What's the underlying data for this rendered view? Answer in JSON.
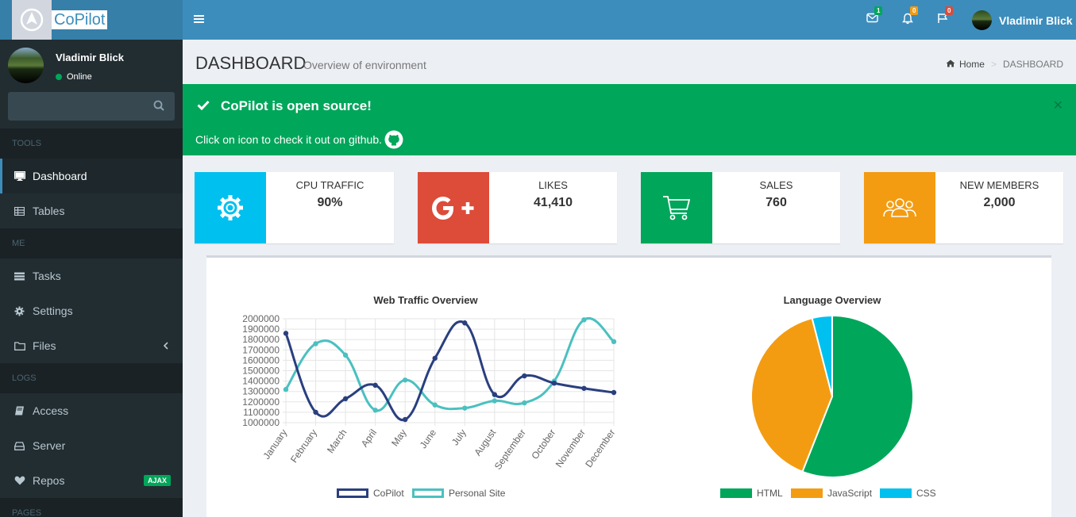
{
  "brand": {
    "name": "CoPilot"
  },
  "header": {
    "user_name": "Vladimir Blick",
    "messages_count": "1",
    "notifications_count": "0",
    "flags_count": "0"
  },
  "sidebar": {
    "user_name": "Vladimir Blick",
    "status": "Online",
    "search_placeholder": "",
    "sections": [
      {
        "header": "TOOLS",
        "items": [
          {
            "label": "Dashboard",
            "icon": "desktop-icon"
          },
          {
            "label": "Tables",
            "icon": "table-icon"
          }
        ]
      },
      {
        "header": "ME",
        "items": [
          {
            "label": "Tasks",
            "icon": "tasks-icon"
          },
          {
            "label": "Settings",
            "icon": "cog-icon"
          },
          {
            "label": "Files",
            "icon": "folder-icon"
          }
        ]
      },
      {
        "header": "LOGS",
        "items": [
          {
            "label": "Access",
            "icon": "book-icon"
          },
          {
            "label": "Server",
            "icon": "hdd-icon"
          },
          {
            "label": "Repos",
            "icon": "heart-icon",
            "badge": "AJAX"
          }
        ]
      },
      {
        "header": "PAGES"
      }
    ]
  },
  "page": {
    "title": "DASHBOARD",
    "subtitle": "Overview of environment",
    "breadcrumb": [
      "Home",
      "DASHBOARD"
    ]
  },
  "callout": {
    "title": "CoPilot is open source!",
    "text": "Click on icon to check it out on github."
  },
  "info_boxes": [
    {
      "label": "CPU TRAFFIC",
      "value": "90%",
      "color": "#00c0ef",
      "icon": "gear-icon"
    },
    {
      "label": "LIKES",
      "value": "41,410",
      "color": "#dd4b39",
      "icon": "google-plus-icon"
    },
    {
      "label": "SALES",
      "value": "760",
      "color": "#00a65a",
      "icon": "shopping-cart-icon"
    },
    {
      "label": "NEW MEMBERS",
      "value": "2,000",
      "color": "#f39c12",
      "icon": "users-icon"
    }
  ],
  "chart_data": [
    {
      "type": "line",
      "title": "Web Traffic Overview",
      "x": [
        "January",
        "February",
        "March",
        "April",
        "May",
        "June",
        "July",
        "August",
        "September",
        "October",
        "November",
        "December"
      ],
      "y_ticks": [
        "2000000",
        "1900000",
        "1800000",
        "1700000",
        "1600000",
        "1500000",
        "1400000",
        "1300000",
        "1200000",
        "1100000",
        "1000000"
      ],
      "ylim": [
        1000000,
        2000000
      ],
      "series": [
        {
          "name": "CoPilot",
          "color": "#2a3f7f",
          "values": [
            1860000,
            1100000,
            1230000,
            1360000,
            1030000,
            1620000,
            1960000,
            1270000,
            1450000,
            1380000,
            1330000,
            1290000
          ]
        },
        {
          "name": "Personal Site",
          "color": "#4bc0c0",
          "values": [
            1320000,
            1760000,
            1650000,
            1120000,
            1410000,
            1170000,
            1140000,
            1210000,
            1190000,
            1400000,
            1990000,
            1780000
          ]
        }
      ]
    },
    {
      "type": "pie",
      "title": "Language Overview",
      "categories": [
        "HTML",
        "JavaScript",
        "CSS"
      ],
      "values": [
        56,
        40,
        4
      ],
      "colors": [
        "#00a65a",
        "#f39c12",
        "#00c0ef"
      ]
    }
  ]
}
